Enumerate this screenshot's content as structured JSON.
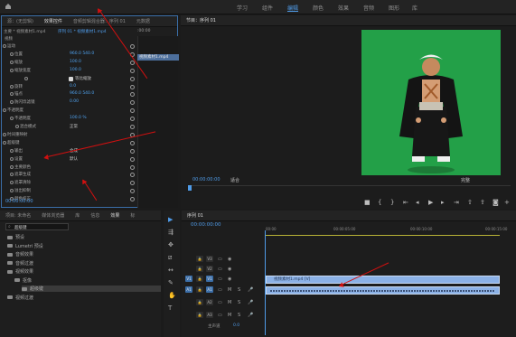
{
  "workspaces": [
    "学习",
    "组件",
    "编辑",
    "颜色",
    "效果",
    "音频",
    "图形",
    "库"
  ],
  "active_workspace": "编辑",
  "effect_controls": {
    "tabs": [
      "源：(无剪辑)",
      "效果控件",
      "音频剪辑混合器：序列 01",
      "元数据"
    ],
    "source_path": "主要 * 视频素材1.mp4",
    "sequence_path": "序列 01 * 视频素材1.mp4",
    "mini_timecode": ":00:00",
    "clip_chip": "视频素材1.mp4",
    "section_video": "视频",
    "rows": [
      {
        "label": "运动",
        "value": ""
      },
      {
        "label": "位置",
        "value": "960.0    540.0"
      },
      {
        "label": "缩放",
        "value": "100.0"
      },
      {
        "label": "缩放宽度",
        "value": "100.0"
      },
      {
        "label": "",
        "value": "等比缩放",
        "check": true
      },
      {
        "label": "旋转",
        "value": "0.0"
      },
      {
        "label": "锚点",
        "value": "960.0    540.0"
      },
      {
        "label": "防闪烁滤镜",
        "value": "0.00"
      },
      {
        "label": "不透明度",
        "value": ""
      },
      {
        "label": "不透明度",
        "value": "100.0 %"
      },
      {
        "label": "混合模式",
        "value": "正常"
      },
      {
        "label": "时间重映射",
        "value": ""
      },
      {
        "label": "超级键",
        "value": ""
      },
      {
        "label": "输出",
        "value": "合成"
      },
      {
        "label": "设置",
        "value": "默认"
      },
      {
        "label": "主要颜色",
        "value": ""
      },
      {
        "label": "遮罩生成",
        "value": ""
      },
      {
        "label": "遮罩清除",
        "value": ""
      },
      {
        "label": "溢出抑制",
        "value": ""
      },
      {
        "label": "颜色校正",
        "value": ""
      }
    ],
    "bottom_timecode": "00:00:00:00"
  },
  "program_monitor": {
    "title": "节目：序列 01",
    "timecode": "00:00:00:00",
    "fit": "适合",
    "ratio": "完整"
  },
  "project": {
    "tabs": [
      "项目: 未命名",
      "媒体浏览器",
      "库",
      "信息",
      "效果",
      "标"
    ],
    "search_placeholder": "",
    "tree": [
      {
        "label": "预设",
        "indent": 0
      },
      {
        "label": "Lumetri 预设",
        "indent": 0
      },
      {
        "label": "音频效果",
        "indent": 0
      },
      {
        "label": "音频过渡",
        "indent": 0
      },
      {
        "label": "视频效果",
        "indent": 0
      },
      {
        "label": "抠像",
        "indent": 1
      },
      {
        "label": "超级键",
        "indent": 2
      },
      {
        "label": "视频过渡",
        "indent": 0
      }
    ]
  },
  "timeline": {
    "title": "序列 01",
    "timecode": "00:00:00:00",
    "ruler": [
      "00:00",
      "00:00:05:00",
      "00:00:10:00",
      "00:00:15:00"
    ],
    "tracks": [
      "V3",
      "V2",
      "V1",
      "A1",
      "A2",
      "A3"
    ],
    "master": "主声道",
    "master_value": "0.0",
    "clip_label": "视频素材1.mp4 [V]"
  },
  "accent": "#4f9be8"
}
